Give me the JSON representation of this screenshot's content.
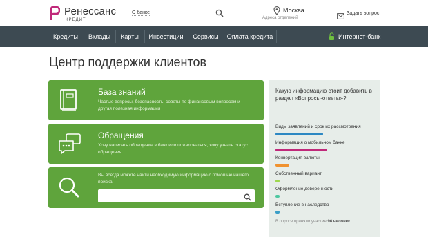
{
  "header": {
    "logo_name": "Ренессанс",
    "logo_sub": "КРЕДИТ",
    "about": "О банке",
    "city": "Москва",
    "branches": "Адреса отделений",
    "ask": "Задать вопрос"
  },
  "nav": {
    "items": [
      "Кредиты",
      "Вклады",
      "Карты",
      "Инвестиции",
      "Сервисы",
      "Оплата кредита"
    ],
    "netbank": "Интернет-банк"
  },
  "page_title": "Центр поддержки клиентов",
  "cards": {
    "knowledge": {
      "title": "База знаний",
      "desc": "Частые вопросы, безопасность, советы по финансовым вопросам и другая полезная информация"
    },
    "appeals": {
      "title": "Обращения",
      "desc": "Хочу написать обращение в банк или пожаловаться, хочу узнать статус обращения"
    },
    "search": {
      "desc": "Вы всегда можете найти необходимую информацию с помощью нашего поиска"
    }
  },
  "poll": {
    "question": "Какую информацию стоит добавить в раздел «Вопросы-ответы»?",
    "options": [
      {
        "label": "Виды заявлений и срок их рассмотрения",
        "value": 0.48,
        "color": "#2d88c3"
      },
      {
        "label": "Информация о мобильном банке",
        "value": 0.52,
        "color": "#c0297a"
      },
      {
        "label": "Конвертация валюты",
        "value": 0.14,
        "color": "#f0922f"
      },
      {
        "label": "Собственный вариант",
        "value": 0.04,
        "color": "#9ed84e"
      },
      {
        "label": "Оформление доверенности",
        "value": 0.03,
        "color": "#4ec8a0"
      },
      {
        "label": "Вступление в наследство",
        "value": 0.03,
        "color": "#3a9ec7"
      }
    ],
    "note_prefix": "В опросе приняли участие",
    "note_count": "96 человек"
  },
  "colors": {
    "accent": "#5fa43c",
    "nav_bg": "#3d4a52",
    "brand": "#c0297a"
  }
}
